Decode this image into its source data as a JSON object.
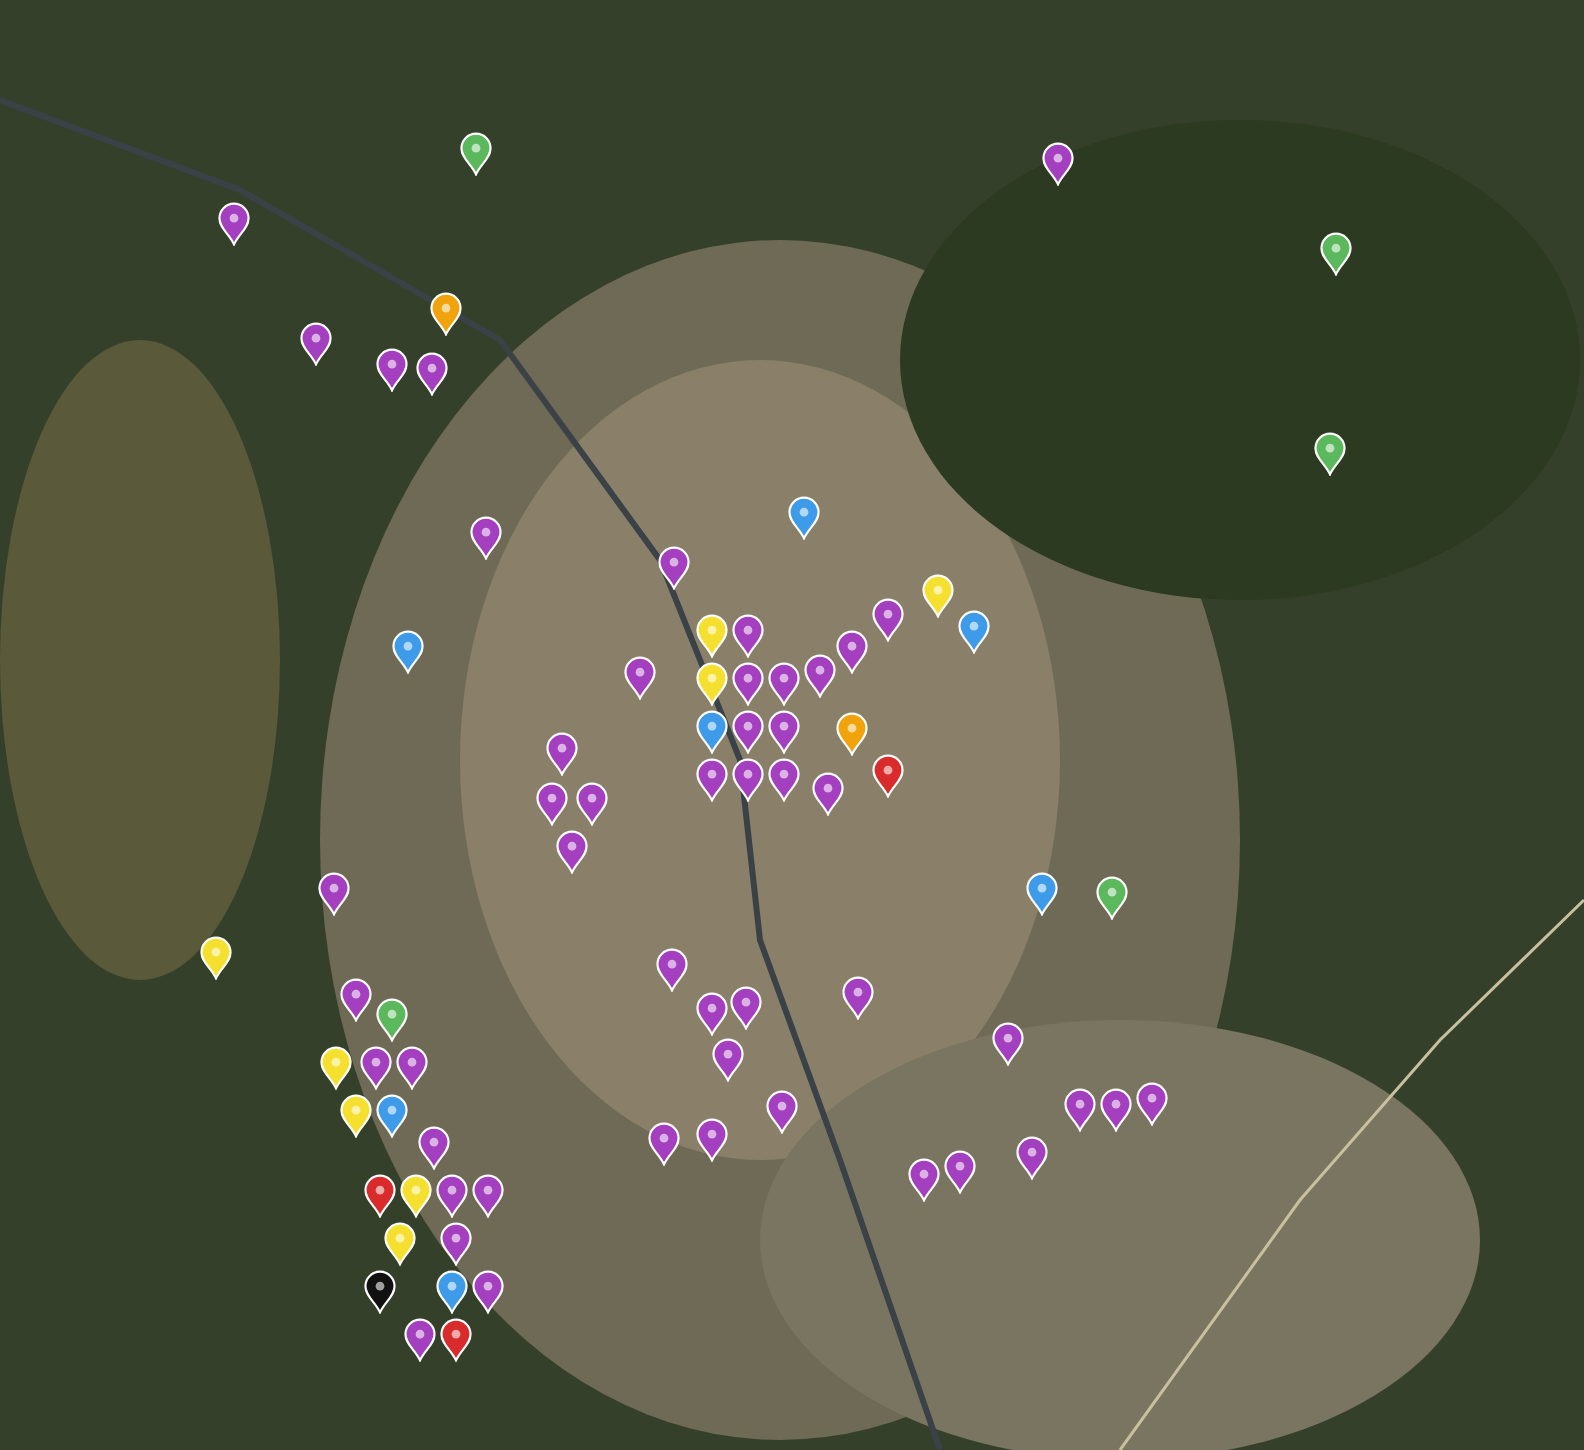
{
  "map": {
    "pins": [
      {
        "color": "#5cb85c"
      },
      {
        "color": "#a43fbf"
      },
      {
        "color": "#a43fbf"
      },
      {
        "color": "#5cb85c"
      },
      {
        "color": "#f0a30a"
      },
      {
        "color": "#a43fbf"
      },
      {
        "color": "#a43fbf"
      },
      {
        "color": "#a43fbf"
      },
      {
        "color": "#5cb85c"
      },
      {
        "color": "#3d9be9"
      },
      {
        "color": "#a43fbf"
      },
      {
        "color": "#a43fbf"
      },
      {
        "color": "#f5e030"
      },
      {
        "color": "#3d9be9"
      },
      {
        "color": "#a43fbf"
      },
      {
        "color": "#a43fbf"
      },
      {
        "color": "#a43fbf"
      },
      {
        "color": "#3d9be9"
      },
      {
        "color": "#a43fbf"
      },
      {
        "color": "#f5e030"
      },
      {
        "color": "#a43fbf"
      },
      {
        "color": "#a43fbf"
      },
      {
        "color": "#f5e030"
      },
      {
        "color": "#3d9be9"
      },
      {
        "color": "#a43fbf"
      },
      {
        "color": "#a43fbf"
      },
      {
        "color": "#a43fbf"
      },
      {
        "color": "#a43fbf"
      },
      {
        "color": "#f0a30a"
      },
      {
        "color": "#a43fbf"
      },
      {
        "color": "#a43fbf"
      },
      {
        "color": "#d92b2b"
      },
      {
        "color": "#a43fbf"
      },
      {
        "color": "#a43fbf"
      },
      {
        "color": "#a43fbf"
      },
      {
        "color": "#a43fbf"
      },
      {
        "color": "#a43fbf"
      },
      {
        "color": "#a43fbf"
      },
      {
        "color": "#3d9be9"
      },
      {
        "color": "#5cb85c"
      },
      {
        "color": "#f5e030"
      },
      {
        "color": "#a43fbf"
      },
      {
        "color": "#a43fbf"
      },
      {
        "color": "#a43fbf"
      },
      {
        "color": "#a43fbf"
      },
      {
        "color": "#a43fbf"
      },
      {
        "color": "#a43fbf"
      },
      {
        "color": "#a43fbf"
      },
      {
        "color": "#5cb85c"
      },
      {
        "color": "#a43fbf"
      },
      {
        "color": "#f5e030"
      },
      {
        "color": "#f5e030"
      },
      {
        "color": "#a43fbf"
      },
      {
        "color": "#3d9be9"
      },
      {
        "color": "#a43fbf"
      },
      {
        "color": "#a43fbf"
      },
      {
        "color": "#a43fbf"
      },
      {
        "color": "#a43fbf"
      },
      {
        "color": "#a43fbf"
      },
      {
        "color": "#a43fbf"
      },
      {
        "color": "#a43fbf"
      },
      {
        "color": "#a43fbf"
      },
      {
        "color": "#a43fbf"
      },
      {
        "color": "#a43fbf"
      },
      {
        "color": "#a43fbf"
      },
      {
        "color": "#a43fbf"
      },
      {
        "color": "#f5e030"
      },
      {
        "color": "#d92b2b"
      },
      {
        "color": "#a43fbf"
      },
      {
        "color": "#f5e030"
      },
      {
        "color": "#3d9be9"
      },
      {
        "color": "#a43fbf"
      },
      {
        "color": "#111111"
      },
      {
        "color": "#d92b2b"
      },
      {
        "color": "#a43fbf"
      }
    ]
  }
}
